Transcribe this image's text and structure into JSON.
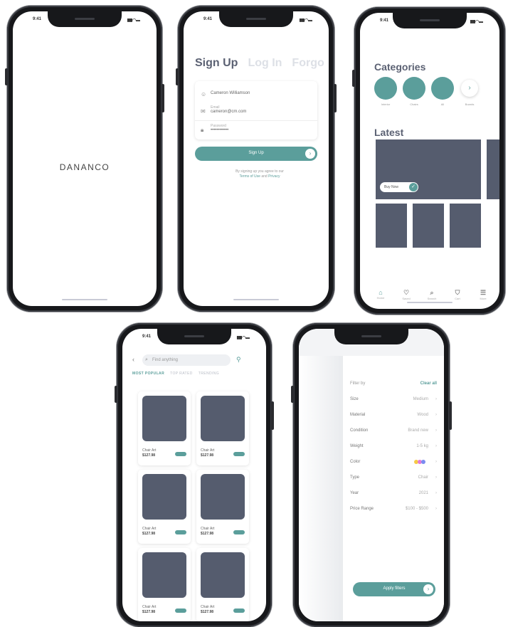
{
  "app": {
    "brand": "DANANCO"
  },
  "status": {
    "time": "9:41",
    "signal": "▮▮▮ ◠ ▬"
  },
  "signup": {
    "tabs": [
      "Sign Up",
      "Log In",
      "Forgo"
    ],
    "fields": [
      {
        "label": "",
        "value": "Cameron Williamson"
      },
      {
        "label": "Email",
        "value": "cameron@cm.com"
      },
      {
        "label": "Password",
        "value": "••••••••••••"
      }
    ],
    "cta": "Sign Up",
    "terms_prefix": "By signing up you agree to our",
    "terms_link1": "Terms of Use",
    "terms_and": "and",
    "terms_link2": "Privacy"
  },
  "home": {
    "categories_title": "Categories",
    "categories": [
      "Interior",
      "Chairs",
      "All",
      "Boards"
    ],
    "latest_title": "Latest",
    "chip_label": "Buy Now",
    "nav": [
      {
        "icon": "⌂",
        "label": "Home"
      },
      {
        "icon": "♡",
        "label": "Saved"
      },
      {
        "icon": "⌕",
        "label": "Search"
      },
      {
        "icon": "⛉",
        "label": "Cart"
      },
      {
        "icon": "☰",
        "label": "More"
      }
    ]
  },
  "search": {
    "placeholder": "Find anything",
    "filter_tabs": [
      "MOST POPULAR",
      "TOP RATED",
      "TRENDING"
    ],
    "products": [
      {
        "name": "Chair Art",
        "price": "$127.98"
      },
      {
        "name": "Chair Art",
        "price": "$127.98"
      },
      {
        "name": "Chair Art",
        "price": "$127.98"
      },
      {
        "name": "Chair Art",
        "price": "$127.98"
      },
      {
        "name": "Chair Art",
        "price": "$127.98"
      },
      {
        "name": "Chair Art",
        "price": "$127.98"
      }
    ]
  },
  "filters": {
    "title": "Filter by",
    "clear": "Clear all",
    "rows": [
      {
        "label": "Size",
        "value": "Medium"
      },
      {
        "label": "Material",
        "value": "Wood"
      },
      {
        "label": "Condition",
        "value": "Brand new"
      },
      {
        "label": "Weight",
        "value": "1-5 kg"
      },
      {
        "label": "Color",
        "value": ""
      },
      {
        "label": "Type",
        "value": "Chair"
      },
      {
        "label": "Year",
        "value": "2021"
      },
      {
        "label": "Price Range",
        "value": "$100 - $500"
      }
    ],
    "apply": "Apply filters"
  },
  "colors": {
    "accent": "#5b9e9b",
    "tile": "#555c6e",
    "swatches": [
      "#f6c945",
      "#e27bd8",
      "#7b8cf0"
    ]
  }
}
